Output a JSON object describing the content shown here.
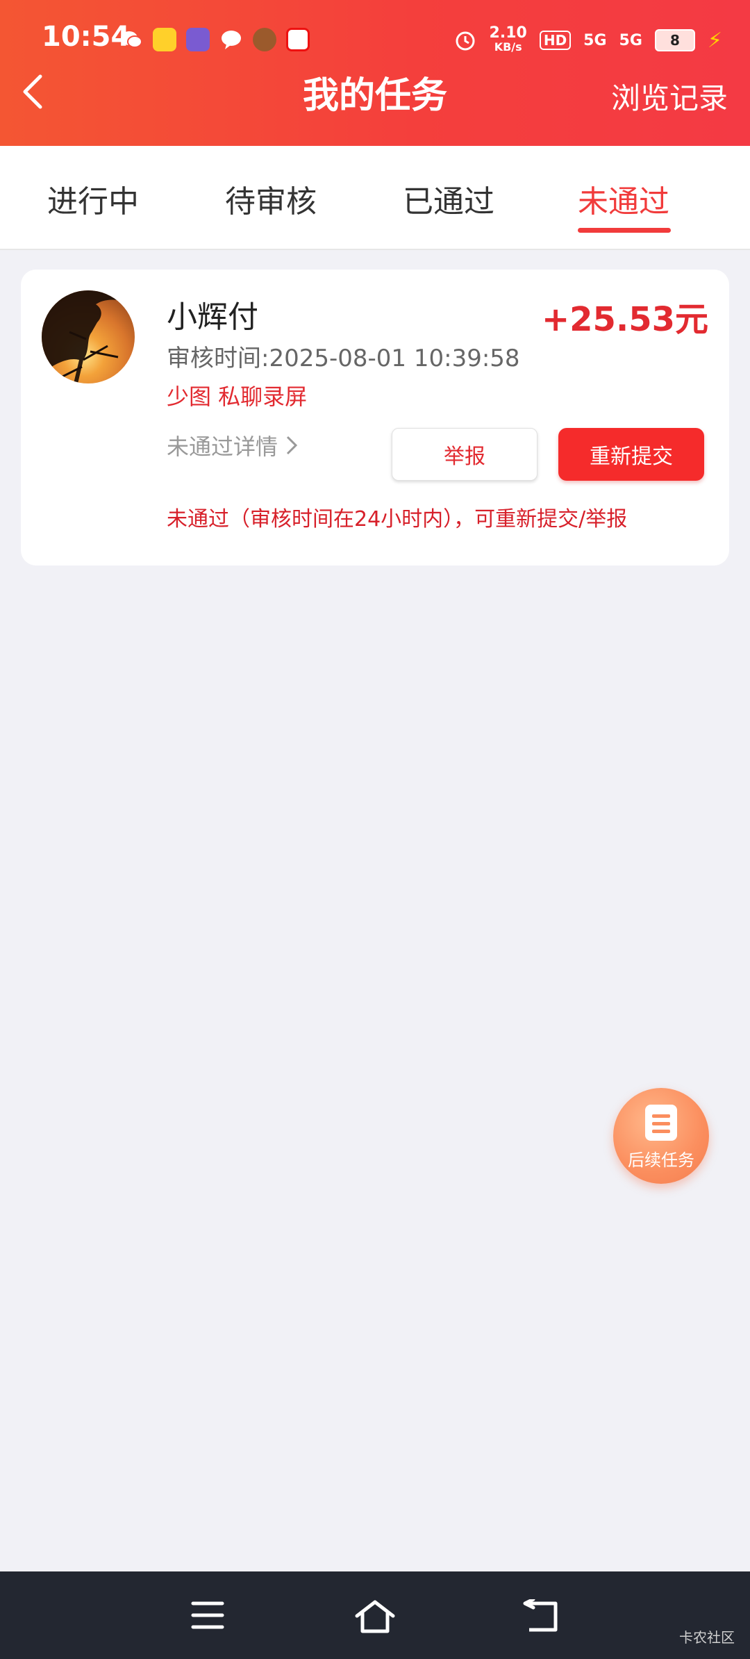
{
  "status_bar": {
    "time": "10:54",
    "net_speed_top": "2.10",
    "net_speed_bottom": "KB/s",
    "signal_1": "5G",
    "signal_2": "5G",
    "battery": "8"
  },
  "header": {
    "title": "我的任务",
    "history_label": "浏览记录"
  },
  "tabs": [
    {
      "label": "进行中",
      "active": false
    },
    {
      "label": "待审核",
      "active": false
    },
    {
      "label": "已通过",
      "active": false
    },
    {
      "label": "未通过",
      "active": true
    }
  ],
  "task": {
    "name": "小辉付",
    "amount": "+25.53元",
    "review_time": "审核时间:2025-08-01 10:39:58",
    "remark": "少图 私聊录屏",
    "detail_link": "未通过详情",
    "report_label": "举报",
    "resubmit_label": "重新提交",
    "notice": "未通过（审核时间在24小时内），可重新提交/举报"
  },
  "fab": {
    "label": "后续任务"
  },
  "watermark": "卡农社区",
  "colors": {
    "accent": "#f13b3b",
    "header_start": "#f45633",
    "header_end": "#f43a44",
    "background": "#f1f1f6"
  }
}
